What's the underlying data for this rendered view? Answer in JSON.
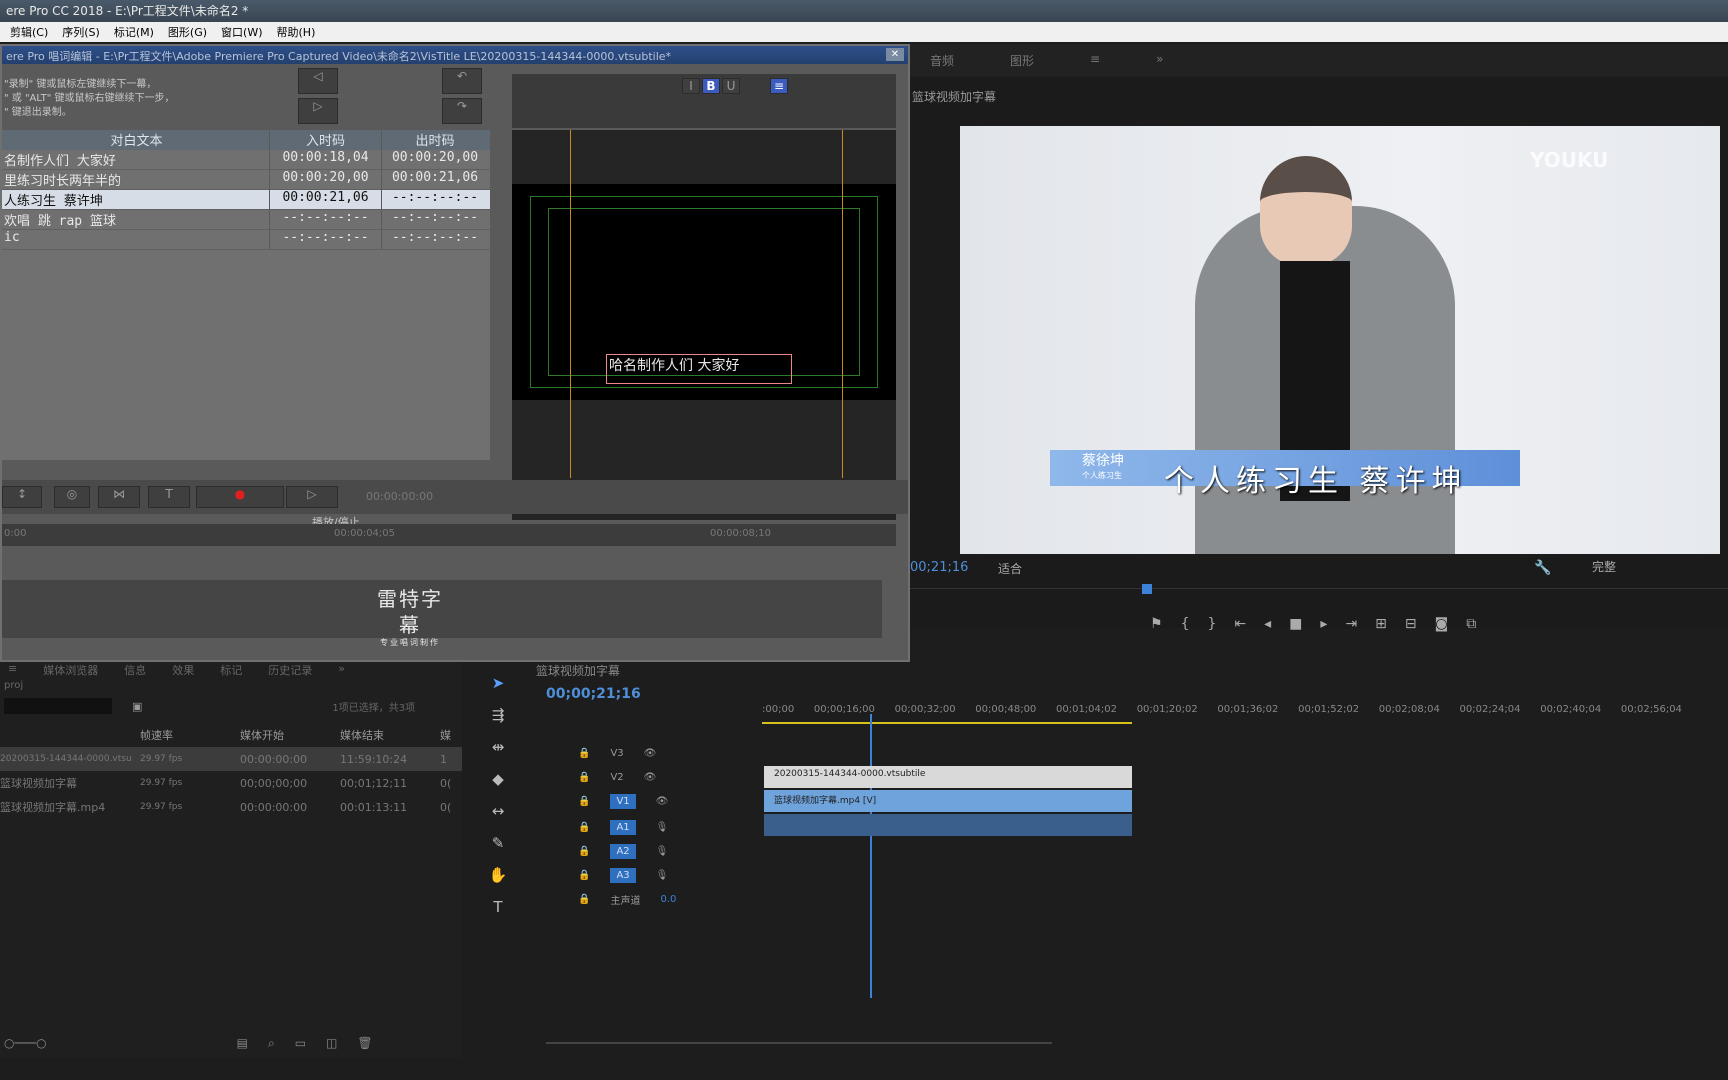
{
  "app": {
    "title": "ere Pro CC 2018 - E:\\Pr工程文件\\未命名2 *",
    "menu": [
      "剪辑(C)",
      "序列(S)",
      "标记(M)",
      "图形(G)",
      "窗口(W)",
      "帮助(H)"
    ]
  },
  "subtitle_window": {
    "title": "ere Pro 唱词编辑 - E:\\Pr工程文件\\Adobe Premiere Pro Captured Video\\未命名2\\VisTitle LE\\20200315-144344-0000.vtsubtile*",
    "instructions": [
      "\"录制\" 键或鼠标左键继续下一幕，",
      "\" 或 \"ALT\" 键或鼠标右键继续下一步，",
      "\" 键退出录制。"
    ],
    "columns": [
      "对白文本",
      "入时码",
      "出时码"
    ],
    "rows": [
      {
        "text": "名制作人们 大家好",
        "in": "00:00:18,04",
        "out": "00:00:20,00"
      },
      {
        "text": "里练习时长两年半的",
        "in": "00:00:20,00",
        "out": "00:00:21,06"
      },
      {
        "text": "人练习生 蔡许坤",
        "in": "00:00:21,06",
        "out": "--:--:--:--"
      },
      {
        "text": "欢唱 跳 rap 篮球",
        "in": "--:--:--:--",
        "out": "--:--:--:--"
      },
      {
        "text": "ic",
        "in": "--:--:--:--",
        "out": "--:--:--:--"
      }
    ],
    "preview_caption": "哈名制作人们 大家好",
    "timecode_display": "00:00:00:00",
    "ruler": [
      "0:00",
      "00:00:04;05",
      "00:00:08;10"
    ],
    "tooltip": "播放/停止",
    "logo": [
      "雷特字幕",
      "专业唱词制作"
    ]
  },
  "panel_tabs": [
    "音频",
    "图形",
    "≡",
    "»"
  ],
  "program_monitor": {
    "label": "篮球视频加字幕",
    "timecode": "00;21;16",
    "fit": "适合",
    "quality": "完整",
    "video_name_tag": "蔡徐坤",
    "video_name_sub": "个人练习生",
    "video_subtitle": "个人练习生 蔡许坤",
    "watermark": "YOUKU"
  },
  "project_panel": {
    "tabs": [
      "≡",
      "媒体浏览器",
      "信息",
      "效果",
      "标记",
      "历史记录",
      "»"
    ],
    "filename": "proj",
    "selection_status": "1项已选择，共3项",
    "columns": [
      "帧速率",
      "媒体开始",
      "媒体结束",
      "媒"
    ],
    "items": [
      {
        "name": "20200315-144344-0000.vtsu",
        "fps": "29.97 fps",
        "start": "00:00:00:00",
        "end": "11:59:10:24",
        "extra": "1"
      },
      {
        "name": "篮球视频加字幕",
        "fps": "29.97 fps",
        "start": "00;00;00;00",
        "end": "00;01;12;11",
        "extra": "0("
      },
      {
        "name": "篮球视频加字幕.mp4",
        "fps": "29.97 fps",
        "start": "00:00:00:00",
        "end": "00:01:13:11",
        "extra": "0("
      }
    ]
  },
  "timeline": {
    "title": "篮球视频加字幕",
    "timecode": "00;00;21;16",
    "ruler": [
      ":00;00",
      "00;00;16;00",
      "00;00;32;00",
      "00;00;48;00",
      "00;01;04;02",
      "00;01;20;02",
      "00;01;36;02",
      "00;01;52;02",
      "00;02;08;04",
      "00;02;24;04",
      "00;02;40;04",
      "00;02;56;04"
    ],
    "tracks": [
      {
        "id": "V3"
      },
      {
        "id": "V2"
      },
      {
        "id": "V1"
      },
      {
        "id": "A1"
      },
      {
        "id": "A2"
      },
      {
        "id": "A3"
      }
    ],
    "master_label": "主声道",
    "master_value": "0.0",
    "clip_v2": "20200315-144344-0000.vtsubtile",
    "clip_v1": "篮球视频加字幕.mp4 [V]"
  }
}
